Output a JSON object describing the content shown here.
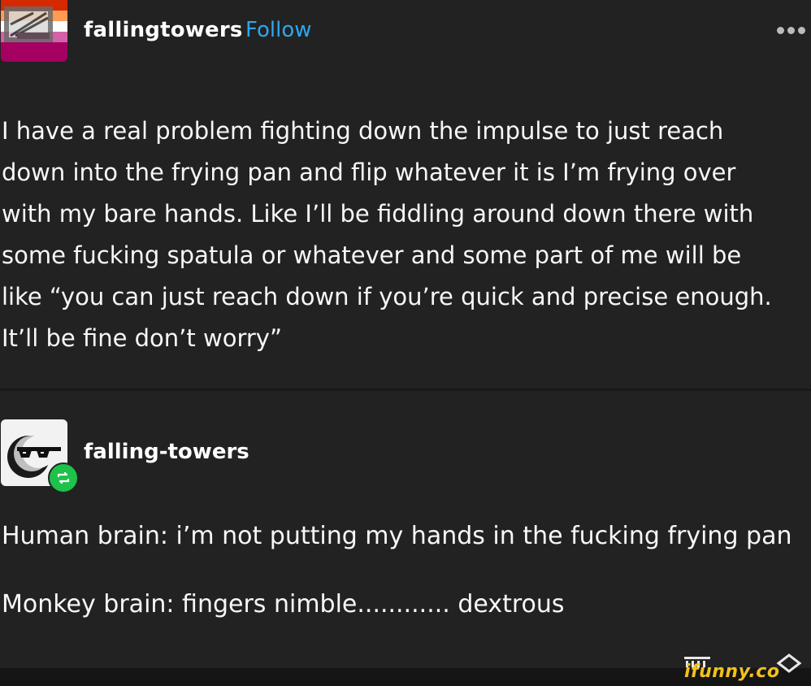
{
  "post": {
    "author": "fallingtowers",
    "follow_label": "Follow",
    "more_icon": "ellipsis-icon",
    "body": "I have a real problem fighting down the impulse to just reach\ndown into the frying pan and flip whatever it is I’m frying over\nwith my bare hands. Like I’ll be fiddling around down there with\nsome fucking spatula or whatever and some part of me will be\nlike “you can just reach down if you’re quick and precise enough.\nIt’ll be fine don’t worry”"
  },
  "reblog": {
    "author": "falling-towers",
    "line1": "Human brain: i’m not putting my hands in the fucking frying pan",
    "line2": "Monkey brain: fingers nimble............ dextrous"
  },
  "watermark": {
    "text": "ifunny.co"
  },
  "colors": {
    "background": "#222222",
    "follow": "#2ea7ee",
    "reblog_badge": "#1ec24a",
    "watermark": "#f2c21b"
  }
}
